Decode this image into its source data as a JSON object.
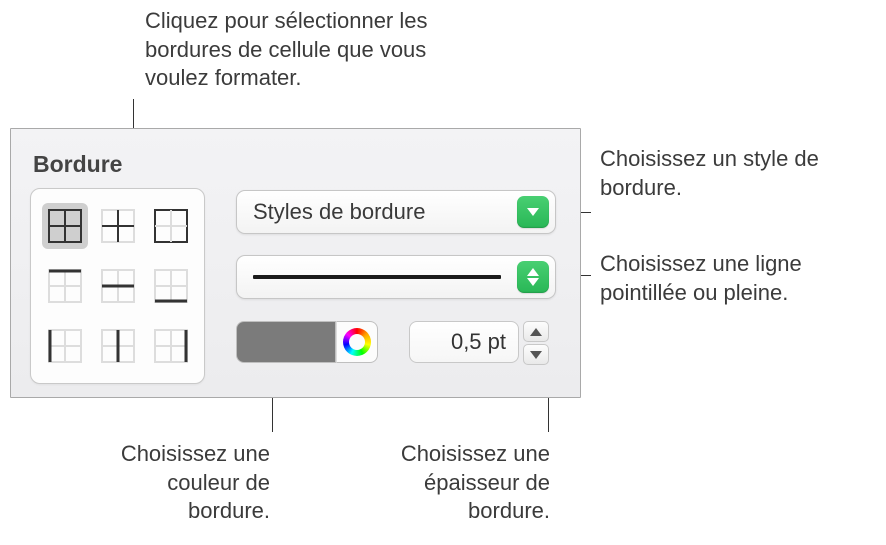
{
  "panel": {
    "title": "Bordure",
    "style_dropdown_label": "Styles de bordure",
    "thickness_value": "0,5 pt",
    "color_swatch_hex": "#7b7b7b"
  },
  "callouts": {
    "grid": "Cliquez pour sélectionner les bordures de cellule que vous voulez formater.",
    "style": "Choisissez un style de bordure.",
    "line": "Choisissez une ligne pointillée ou pleine.",
    "color": "Choisissez une couleur de bordure.",
    "thickness": "Choisissez une épaisseur de bordure."
  }
}
